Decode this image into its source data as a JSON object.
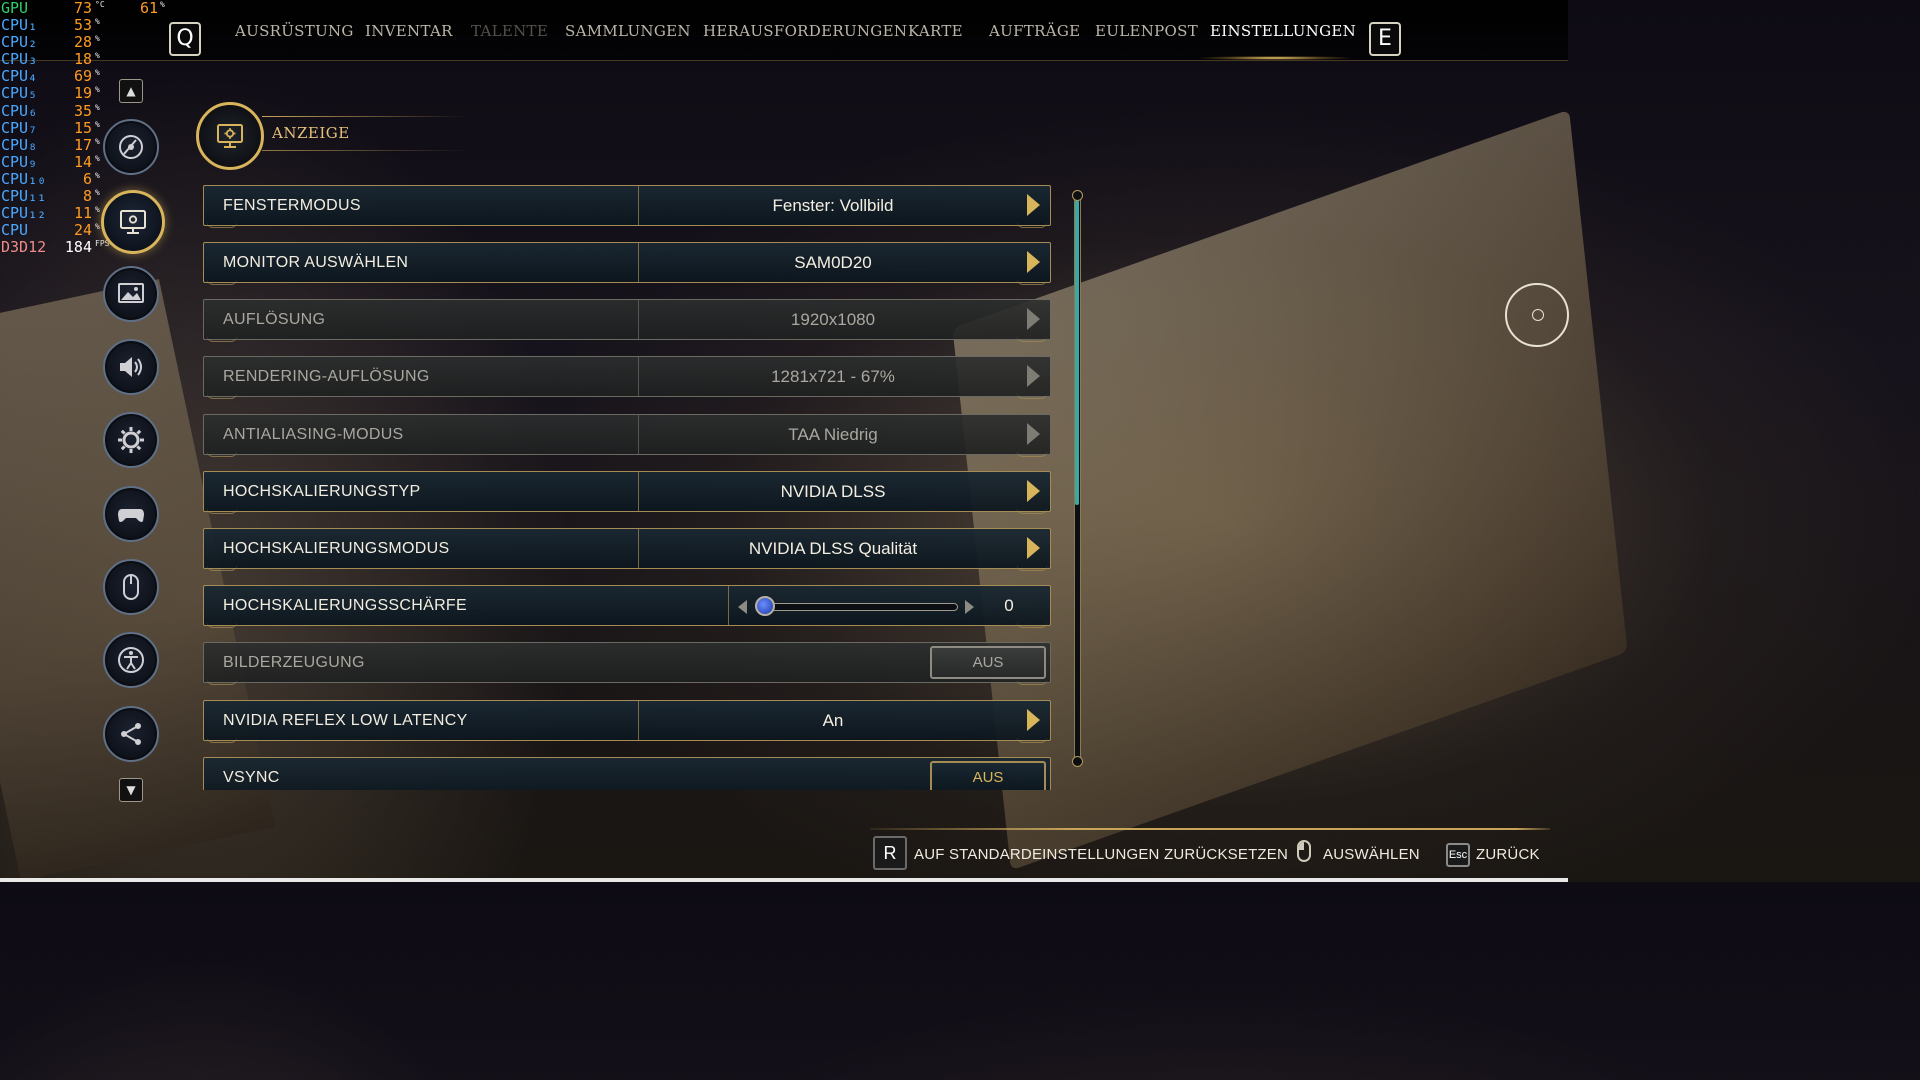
{
  "perf": {
    "rows": [
      {
        "label": "GPU",
        "value": "73",
        "unit": "°C",
        "extra": "61",
        "extra_unit": "%"
      },
      {
        "label": "CPU₁",
        "value": "53",
        "unit": "%"
      },
      {
        "label": "CPU₂",
        "value": "28",
        "unit": "%"
      },
      {
        "label": "CPU₃",
        "value": "18",
        "unit": "%"
      },
      {
        "label": "CPU₄",
        "value": "69",
        "unit": "%"
      },
      {
        "label": "CPU₅",
        "value": "19",
        "unit": "%"
      },
      {
        "label": "CPU₆",
        "value": "35",
        "unit": "%"
      },
      {
        "label": "CPU₇",
        "value": "15",
        "unit": "%"
      },
      {
        "label": "CPU₈",
        "value": "17",
        "unit": "%"
      },
      {
        "label": "CPU₉",
        "value": "14",
        "unit": "%"
      },
      {
        "label": "CPU₁₀",
        "value": "6",
        "unit": "%"
      },
      {
        "label": "CPU₁₁",
        "value": "8",
        "unit": "%"
      },
      {
        "label": "CPU₁₂",
        "value": "11",
        "unit": "%"
      },
      {
        "label": "CPU",
        "value": "24",
        "unit": "%"
      },
      {
        "label": "D3D12",
        "value": "184",
        "unit": "FPS"
      }
    ],
    "gpu_tag": "GPU FPS"
  },
  "nav": {
    "left_key": "Q",
    "right_key": "E",
    "tabs": [
      {
        "label": "AUSRÜSTUNG",
        "state": "normal"
      },
      {
        "label": "INVENTAR",
        "state": "normal"
      },
      {
        "label": "TALENTE",
        "state": "disabled"
      },
      {
        "label": "SAMMLUNGEN",
        "state": "normal"
      },
      {
        "label": "HERAUSFORDERUNGEN",
        "state": "normal"
      },
      {
        "label": "KARTE",
        "state": "normal"
      },
      {
        "label": "AUFTRÄGE",
        "state": "normal"
      },
      {
        "label": "EULENPOST",
        "state": "normal"
      },
      {
        "label": "EINSTELLUNGEN",
        "state": "active"
      }
    ],
    "accent": "#d8b45a"
  },
  "sidebar": {
    "up_arrow": "▲",
    "down_arrow": "▼",
    "categories": [
      {
        "icon": "disc-icon",
        "active": false
      },
      {
        "icon": "monitor-gear-icon",
        "active": true
      },
      {
        "icon": "image-icon",
        "active": false
      },
      {
        "icon": "speaker-icon",
        "active": false
      },
      {
        "icon": "gear-icon",
        "active": false
      },
      {
        "icon": "gamepad-icon",
        "active": false
      },
      {
        "icon": "mouse-icon",
        "active": false
      },
      {
        "icon": "accessibility-icon",
        "active": false
      },
      {
        "icon": "share-icon",
        "active": false
      }
    ]
  },
  "section": {
    "title": "ANZEIGE",
    "icon": "monitor-gear-icon"
  },
  "settings": [
    {
      "label": "FENSTERMODUS",
      "value": "Fenster: Vollbild",
      "type": "select",
      "enabled": true
    },
    {
      "label": "MONITOR AUSWÄHLEN",
      "value": "SAM0D20",
      "type": "select",
      "enabled": true
    },
    {
      "label": "AUFLÖSUNG",
      "value": "1920x1080",
      "type": "select",
      "enabled": false
    },
    {
      "label": "RENDERING-AUFLÖSUNG",
      "value": "1281x721 - 67%",
      "type": "select",
      "enabled": false
    },
    {
      "label": "ANTIALIASING-MODUS",
      "value": "TAA Niedrig",
      "type": "select",
      "enabled": false
    },
    {
      "label": "HOCHSKALIERUNGSTYP",
      "value": "NVIDIA DLSS",
      "type": "select",
      "enabled": true
    },
    {
      "label": "HOCHSKALIERUNGSMODUS",
      "value": "NVIDIA DLSS Qualität",
      "type": "select",
      "enabled": true
    },
    {
      "label": "HOCHSKALIERUNGSSCHÄRFE",
      "value": "0",
      "type": "slider",
      "enabled": true,
      "slider_fraction": 0.0
    },
    {
      "label": "BILDERZEUGUNG",
      "value": "AUS",
      "type": "toggle",
      "enabled": false
    },
    {
      "label": "NVIDIA REFLEX LOW LATENCY",
      "value": "An",
      "type": "select",
      "enabled": true
    },
    {
      "label": "VSYNC",
      "value": "AUS",
      "type": "toggle",
      "enabled": true
    }
  ],
  "footer": {
    "reset_key": "R",
    "reset_label": "AUF STANDARDEINSTELLUNGEN ZURÜCKSETZEN",
    "select_label": "AUSWÄHLEN",
    "back_key": "Esc",
    "back_label": "ZURÜCK"
  },
  "scrollbar": {
    "thumb_color": "#3aa9a6"
  }
}
